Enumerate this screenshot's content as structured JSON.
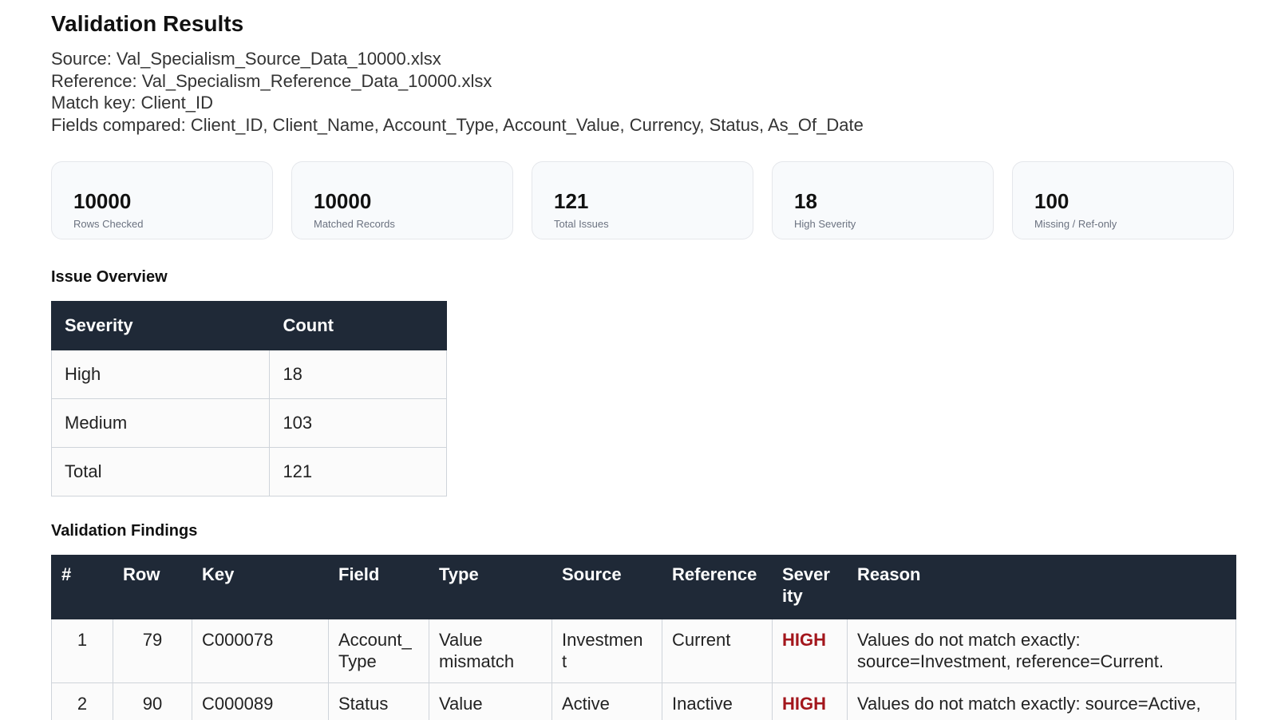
{
  "title": "Validation Results",
  "meta": {
    "source": "Source: Val_Specialism_Source_Data_10000.xlsx",
    "reference": "Reference: Val_Specialism_Reference_Data_10000.xlsx",
    "match_key": "Match key: Client_ID",
    "fields": "Fields compared: Client_ID, Client_Name, Account_Type, Account_Value, Currency, Status, As_Of_Date"
  },
  "cards": [
    {
      "value": "10000",
      "label": "Rows Checked"
    },
    {
      "value": "10000",
      "label": "Matched Records"
    },
    {
      "value": "121",
      "label": "Total Issues"
    },
    {
      "value": "18",
      "label": "High Severity"
    },
    {
      "value": "100",
      "label": "Missing / Ref-only"
    }
  ],
  "overview": {
    "heading": "Issue Overview",
    "headers": [
      "Severity",
      "Count"
    ],
    "rows": [
      {
        "severity": "High",
        "count": "18"
      },
      {
        "severity": "Medium",
        "count": "103"
      },
      {
        "severity": "Total",
        "count": "121"
      }
    ]
  },
  "findings": {
    "heading": "Validation Findings",
    "headers": {
      "num": "#",
      "row": "Row",
      "key": "Key",
      "field": "Field",
      "type": "Type",
      "source": "Source",
      "reference": "Reference",
      "severity_1": "Sever",
      "severity_2": "ity",
      "reason": "Reason"
    },
    "rows": [
      {
        "num": "1",
        "row": "79",
        "key": "C000078",
        "field_1": "Account_",
        "field_2": "Type",
        "type_1": "Value",
        "type_2": "mismatch",
        "source_1": "Investmen",
        "source_2": "t",
        "reference": "Current",
        "severity": "HIGH",
        "reason_1": "Values do not match exactly:",
        "reason_2": "source=Investment, reference=Current."
      },
      {
        "num": "2",
        "row": "90",
        "key": "C000089",
        "field": "Status",
        "type": "Value",
        "source": "Active",
        "reference": "Inactive",
        "severity": "HIGH",
        "reason": "Values do not match exactly: source=Active,"
      }
    ]
  },
  "colors": {
    "header_bg": "#1f2937",
    "severity_high": "#a3161c",
    "card_bg": "#f8fafc"
  }
}
